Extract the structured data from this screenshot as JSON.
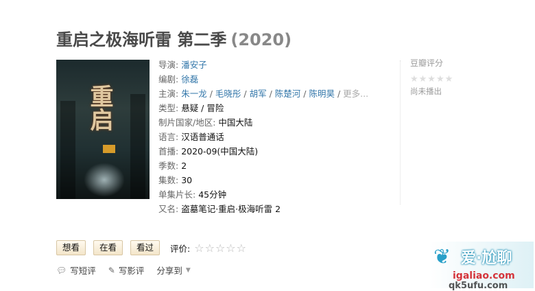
{
  "title": {
    "name": "重启之极海听雷 第二季",
    "year": "(2020)"
  },
  "info": {
    "director_label": "导演:",
    "director": "潘安子",
    "writer_label": "编剧:",
    "writer": "徐磊",
    "cast_label": "主演:",
    "cast": [
      "朱一龙",
      "毛晓彤",
      "胡军",
      "陈楚河",
      "陈明昊"
    ],
    "cast_more": "更多...",
    "separator": " / ",
    "genre_label": "类型:",
    "genre": "悬疑 / 冒险",
    "country_label": "制片国家/地区:",
    "country": "中国大陆",
    "language_label": "语言:",
    "language": "汉语普通话",
    "premiere_label": "首播:",
    "premiere": "2020-09(中国大陆)",
    "seasons_label": "季数:",
    "seasons": "2",
    "episodes_label": "集数:",
    "episodes": "30",
    "runtime_label": "单集片长:",
    "runtime": "45分钟",
    "aka_label": "又名:",
    "aka": "盗墓笔记·重启·极海听雷 2"
  },
  "rating": {
    "label": "豆瓣评分",
    "stars": "★★★★★",
    "status": "尚未播出"
  },
  "actions": {
    "want": "想看",
    "watching": "在看",
    "watched": "看过",
    "rate_label": "评价:",
    "rate_stars": "☆☆☆☆☆"
  },
  "links": {
    "short_review_icon": "speech-bubble-icon",
    "short_review": "写短评",
    "review_icon": "pencil-icon",
    "review": "写影评",
    "share": "分享到",
    "share_caret": "▼"
  },
  "watermark": {
    "cn": "爱·尬聊",
    "url1": "igaliao.com",
    "url2": "qk5ufu.com"
  },
  "colors": {
    "link": "#3377aa",
    "title": "#494949",
    "year": "#888888",
    "button_border": "#d8c6a3",
    "watermark_blue": "#2aa0c9",
    "watermark_red": "#d4343a"
  }
}
